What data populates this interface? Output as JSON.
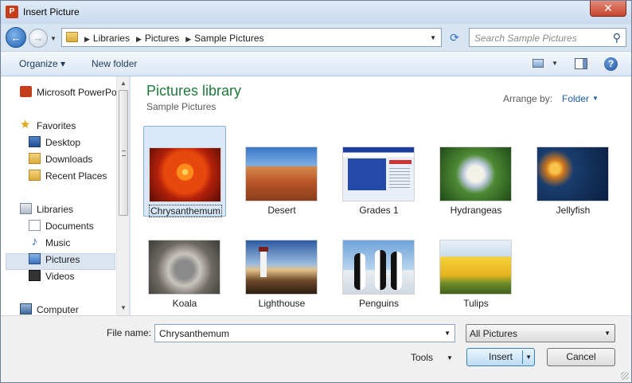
{
  "window": {
    "title": "Insert Picture",
    "close_label": "✕"
  },
  "address": {
    "crumbs": [
      "Libraries",
      "Pictures",
      "Sample Pictures"
    ],
    "search_placeholder": "Search Sample Pictures"
  },
  "toolbar": {
    "organize": "Organize ▾",
    "new_folder": "New folder"
  },
  "nav": {
    "items": [
      {
        "label": "Microsoft PowerPoint",
        "icon": "powerpoint-icon"
      },
      {
        "label": "Favorites",
        "icon": "star-icon"
      },
      {
        "label": "Desktop",
        "icon": "desktop-icon"
      },
      {
        "label": "Downloads",
        "icon": "downloads-folder-icon"
      },
      {
        "label": "Recent Places",
        "icon": "recent-places-icon"
      },
      {
        "label": "Libraries",
        "icon": "libraries-icon"
      },
      {
        "label": "Documents",
        "icon": "documents-icon"
      },
      {
        "label": "Music",
        "icon": "music-icon"
      },
      {
        "label": "Pictures",
        "icon": "pictures-icon"
      },
      {
        "label": "Videos",
        "icon": "videos-icon"
      },
      {
        "label": "Computer",
        "icon": "computer-icon"
      }
    ],
    "selected": "Pictures"
  },
  "content": {
    "title": "Pictures library",
    "subtitle": "Sample Pictures",
    "arrange_label": "Arrange by:",
    "arrange_value": "Folder",
    "files": [
      {
        "name": "Chrysanthemum",
        "selected": true
      },
      {
        "name": "Desert"
      },
      {
        "name": "Grades 1"
      },
      {
        "name": "Hydrangeas"
      },
      {
        "name": "Jellyfish"
      },
      {
        "name": "Koala"
      },
      {
        "name": "Lighthouse"
      },
      {
        "name": "Penguins"
      },
      {
        "name": "Tulips"
      }
    ]
  },
  "bottom": {
    "file_name_label": "File name:",
    "file_name_value": "Chrysanthemum",
    "file_type": "All Pictures",
    "tools": "Tools",
    "insert": "Insert",
    "cancel": "Cancel"
  },
  "colors": {
    "library_title": "#1e7a3b",
    "link": "#1f5fa8",
    "selection": "#d9e8f8"
  }
}
